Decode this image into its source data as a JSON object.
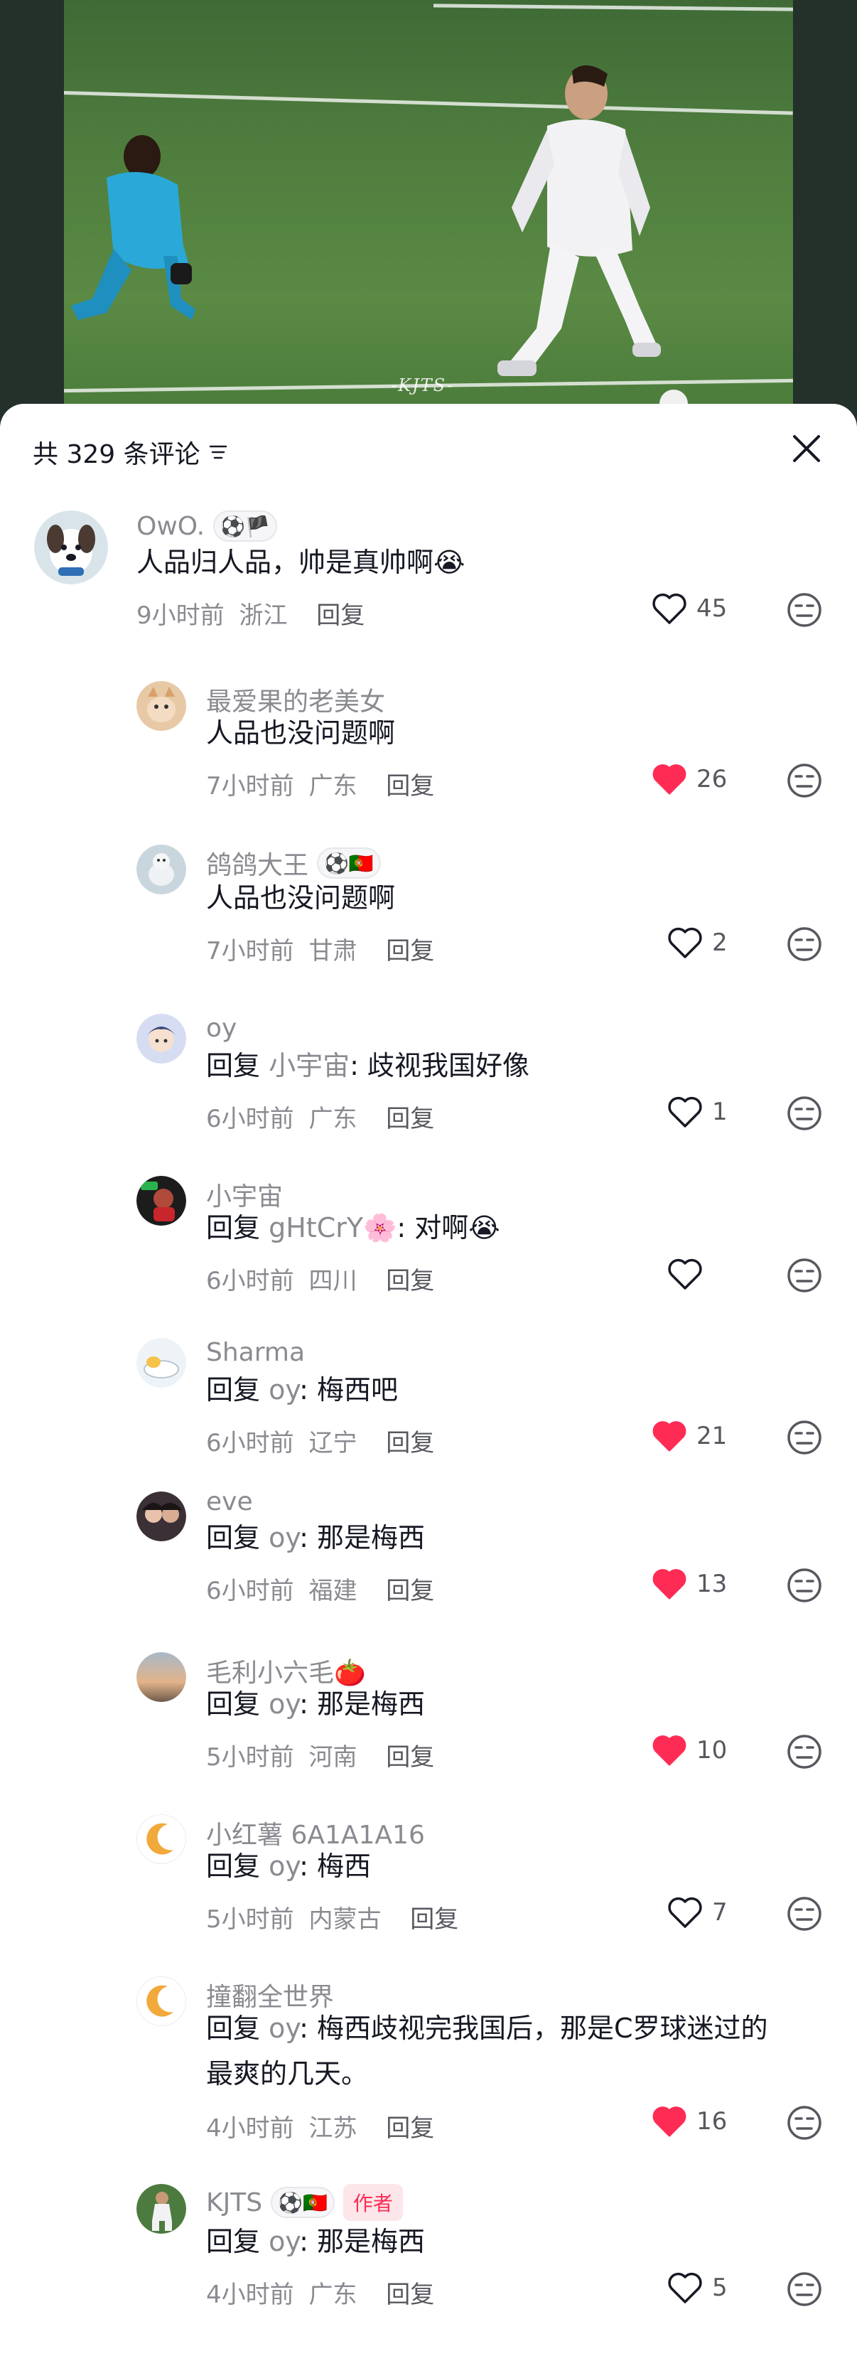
{
  "video": {
    "watermark": "-KJTS-"
  },
  "header": {
    "title": "共 329 条评论",
    "sort_icon": "sort-filter-icon",
    "close_icon": "close-icon"
  },
  "colors": {
    "accent_red": "#fe2c55",
    "secondary_text": "#8a8b91",
    "primary_text": "#161823"
  },
  "comments": [
    {
      "username": "OwO.",
      "badge": "⚽🏴",
      "text": "人品归人品，帅是真帅啊😭",
      "time": "9小时前",
      "location": "浙江",
      "reply_label": "回复",
      "likes": "45",
      "liked": false
    },
    {
      "username": "最爱果的老美女",
      "text": "人品也没问题啊",
      "time": "7小时前",
      "location": "广东",
      "reply_label": "回复",
      "likes": "26",
      "liked": true
    },
    {
      "username": "鸽鸽大王",
      "badge": "⚽🇵🇹",
      "text": "人品也没问题啊",
      "time": "7小时前",
      "location": "甘肃",
      "reply_label": "回复",
      "likes": "2",
      "liked": false
    },
    {
      "username": "oy",
      "reply_word": "回复",
      "reply_to": "小宇宙",
      "text": ": 歧视我国好像",
      "time": "6小时前",
      "location": "广东",
      "reply_label": "回复",
      "likes": "1",
      "liked": false
    },
    {
      "username": "小宇宙",
      "reply_word": "回复",
      "reply_to": "gHtCrY🌸",
      "text": ": 对啊😭",
      "time": "6小时前",
      "location": "四川",
      "reply_label": "回复",
      "likes": "",
      "liked": false
    },
    {
      "username": "Sharma",
      "reply_word": "回复",
      "reply_to": "oy",
      "text": ": 梅西吧",
      "time": "6小时前",
      "location": "辽宁",
      "reply_label": "回复",
      "likes": "21",
      "liked": true
    },
    {
      "username": "eve",
      "reply_word": "回复",
      "reply_to": "oy",
      "text": ": 那是梅西",
      "time": "6小时前",
      "location": "福建",
      "reply_label": "回复",
      "likes": "13",
      "liked": true
    },
    {
      "username": "毛利小六毛🍅",
      "reply_word": "回复",
      "reply_to": "oy",
      "text": ": 那是梅西",
      "time": "5小时前",
      "location": "河南",
      "reply_label": "回复",
      "likes": "10",
      "liked": true
    },
    {
      "username": "小红薯 6A1A1A16",
      "reply_word": "回复",
      "reply_to": "oy",
      "text": ": 梅西",
      "time": "5小时前",
      "location": "内蒙古",
      "reply_label": "回复",
      "likes": "7",
      "liked": false
    },
    {
      "username": "撞翻全世界",
      "reply_word": "回复",
      "reply_to": "oy",
      "text": ": 梅西歧视完我国后，那是C罗球迷过的",
      "text_line2": "最爽的几天。",
      "time": "4小时前",
      "location": "江苏",
      "reply_label": "回复",
      "likes": "16",
      "liked": true
    },
    {
      "username": "KJTS",
      "badge": "⚽🇵🇹",
      "author_tag": "作者",
      "reply_word": "回复",
      "reply_to": "oy",
      "text": ": 那是梅西",
      "time": "4小时前",
      "location": "广东",
      "reply_label": "回复",
      "likes": "5",
      "liked": false
    }
  ]
}
